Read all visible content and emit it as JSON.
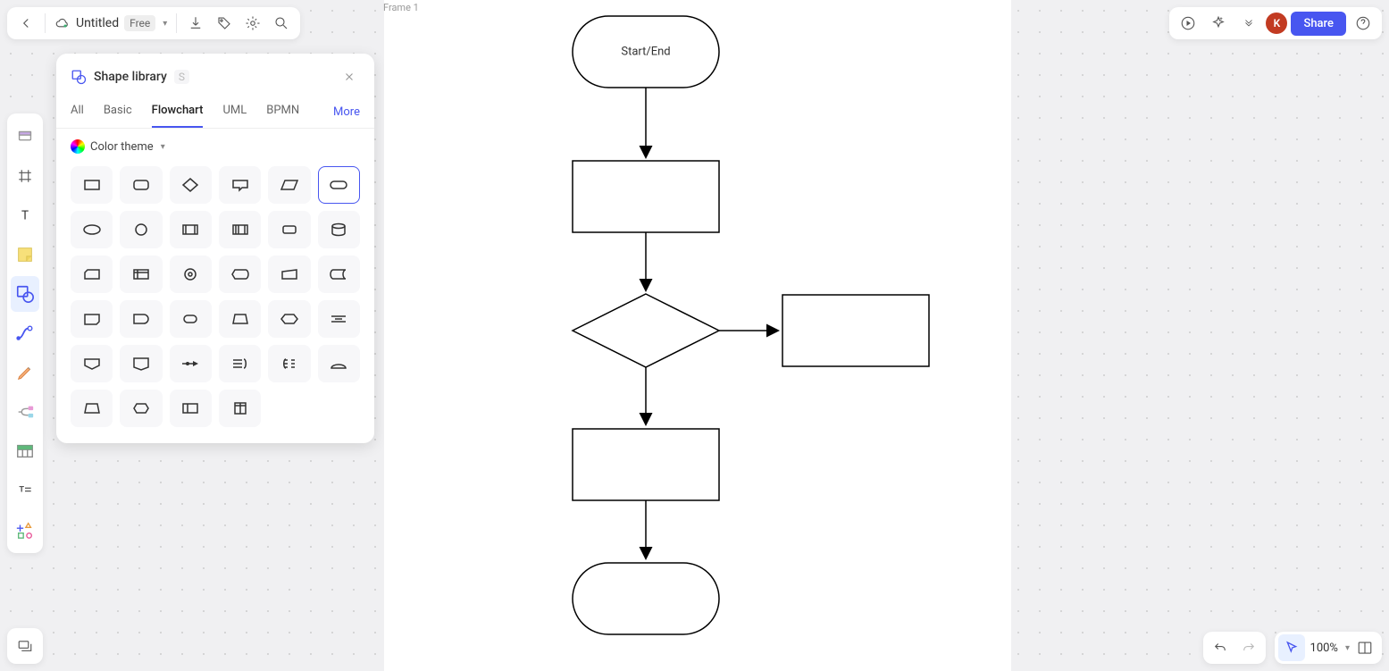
{
  "header": {
    "doc_name": "Untitled",
    "plan_badge": "Free"
  },
  "topright": {
    "share_label": "Share",
    "avatar_initial": "K"
  },
  "shape_panel": {
    "title": "Shape library",
    "shortcut": "S",
    "tabs": [
      "All",
      "Basic",
      "Flowchart",
      "UML",
      "BPMN"
    ],
    "active_tab": "Flowchart",
    "more_label": "More",
    "color_theme_label": "Color theme"
  },
  "canvas": {
    "frame_label": "Frame 1",
    "start_label": "Start/End"
  },
  "bottomright": {
    "zoom_label": "100%"
  },
  "shapes": [
    "rect",
    "round-rect",
    "diamond",
    "callout",
    "parallelogram",
    "terminator",
    "ellipse",
    "circle",
    "predef",
    "predef2",
    "round-small",
    "cylinder",
    "card",
    "internal",
    "connector",
    "display",
    "manual",
    "stored",
    "loop",
    "delay",
    "prep",
    "manual-input",
    "hexagon",
    "divider-shape",
    "offpage",
    "offpage2",
    "summing",
    "or",
    "collate",
    "extract",
    "merge",
    "sort",
    "multidoc",
    "document"
  ],
  "left_tools": [
    {
      "name": "select-tool",
      "active": false
    },
    {
      "name": "frame-tool",
      "active": false
    },
    {
      "name": "text-tool",
      "active": false
    },
    {
      "name": "sticky-tool",
      "active": false
    },
    {
      "name": "shape-tool",
      "active": true
    },
    {
      "name": "connector-tool",
      "active": false
    },
    {
      "name": "pencil-tool",
      "active": false
    },
    {
      "name": "mindmap-tool",
      "active": false
    },
    {
      "name": "table-tool",
      "active": false
    },
    {
      "name": "text-block-tool",
      "active": false
    },
    {
      "name": "more-shapes-tool",
      "active": false
    }
  ]
}
